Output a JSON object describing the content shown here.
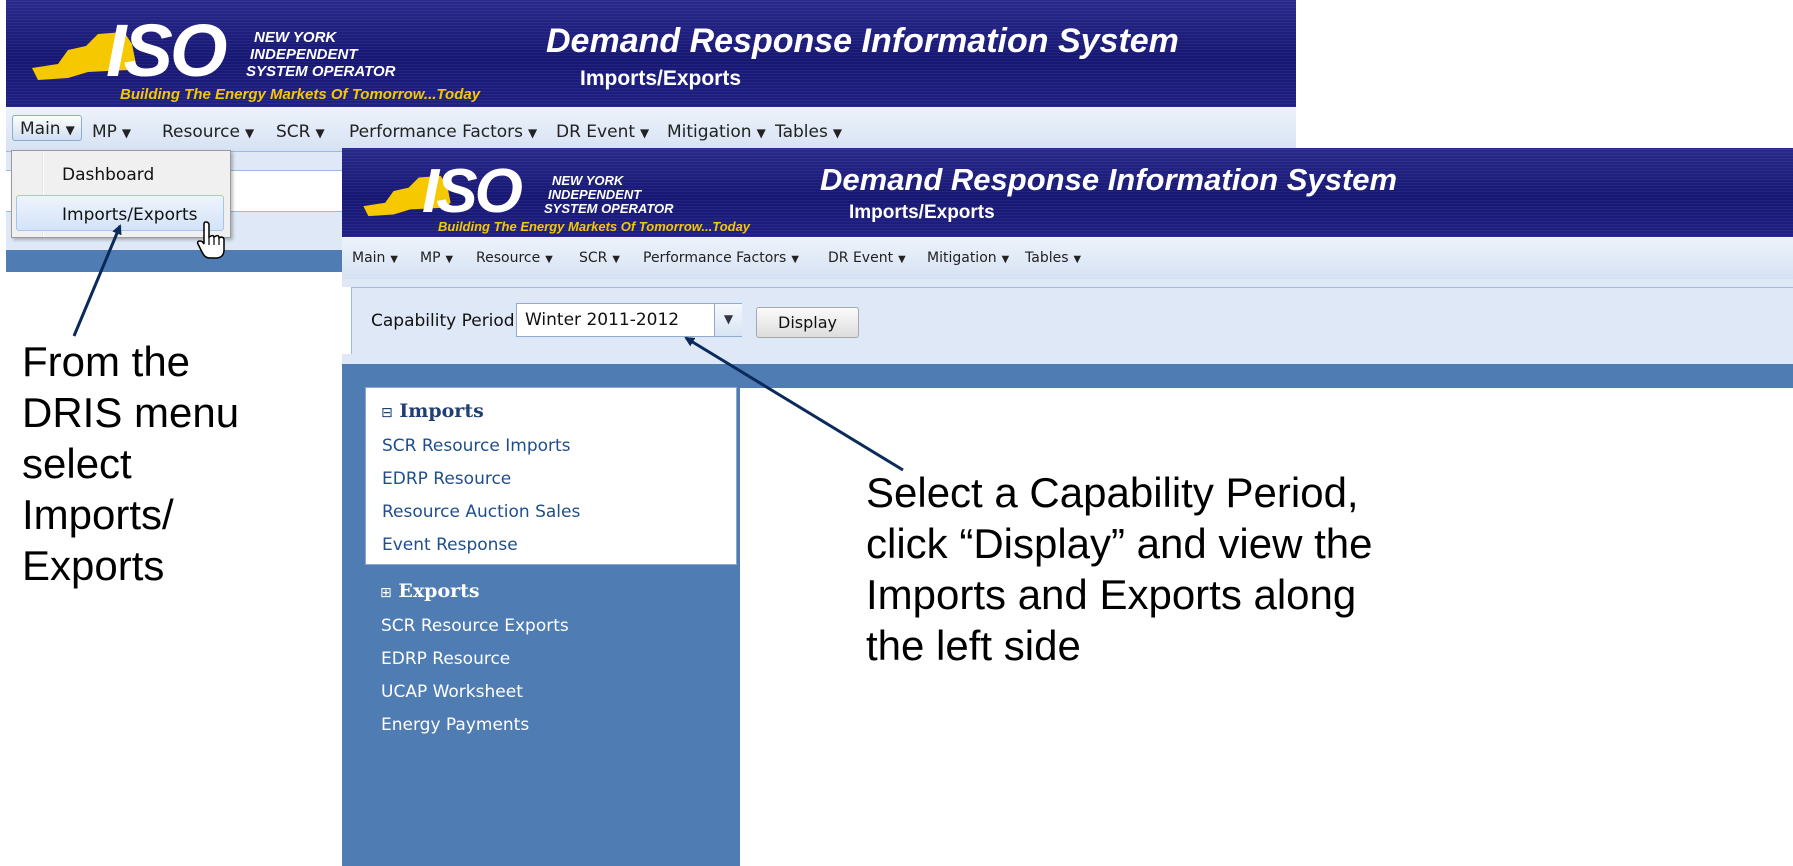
{
  "colors": {
    "banner": "#1c1c7c",
    "menubar": "#d6e2f3",
    "nav_panel": "#4f7cb3",
    "tagline": "#f5c800",
    "link": "#1f4e8c",
    "arrow": "#0b2a5c"
  },
  "logo": {
    "iso": "ISO",
    "ny_line1": "NEW YORK",
    "ny_line2": "INDEPENDENT",
    "ny_line3": "SYSTEM OPERATOR",
    "tagline": "Building The Energy Markets Of Tomorrow...Today"
  },
  "header": {
    "title": "Demand Response Information System",
    "subtitle": "Imports/Exports"
  },
  "menu": [
    {
      "label": "Main",
      "icon": "chevron-down-icon"
    },
    {
      "label": "MP",
      "icon": "chevron-down-icon"
    },
    {
      "label": "Resource",
      "icon": "chevron-down-icon"
    },
    {
      "label": "SCR",
      "icon": "chevron-down-icon"
    },
    {
      "label": "Performance Factors",
      "icon": "chevron-down-icon"
    },
    {
      "label": "DR Event",
      "icon": "chevron-down-icon"
    },
    {
      "label": "Mitigation",
      "icon": "chevron-down-icon"
    },
    {
      "label": "Tables",
      "icon": "chevron-down-icon"
    }
  ],
  "main_dropdown": {
    "items": [
      "Dashboard",
      "Imports/Exports"
    ],
    "highlighted": "Imports/Exports",
    "cursor": "hand-pointer-icon"
  },
  "capability": {
    "label": "Capability Period:",
    "selected": "Winter 2011-2012",
    "button": "Display"
  },
  "nav": {
    "imports": {
      "heading": "Imports",
      "icon": "collapse-icon",
      "links": [
        "SCR Resource Imports",
        "EDRP Resource",
        "Resource Auction Sales",
        "Event Response"
      ]
    },
    "exports": {
      "heading": "Exports",
      "icon": "expand-icon",
      "links": [
        "SCR Resource Exports",
        "EDRP Resource",
        "UCAP Worksheet",
        "Energy Payments"
      ]
    }
  },
  "callouts": {
    "left": [
      "From the",
      "DRIS menu",
      "select",
      "Imports/",
      "Exports"
    ],
    "right": [
      "Select a Capability Period,",
      "click “Display” and view the",
      "Imports and Exports along",
      "the left side"
    ]
  }
}
